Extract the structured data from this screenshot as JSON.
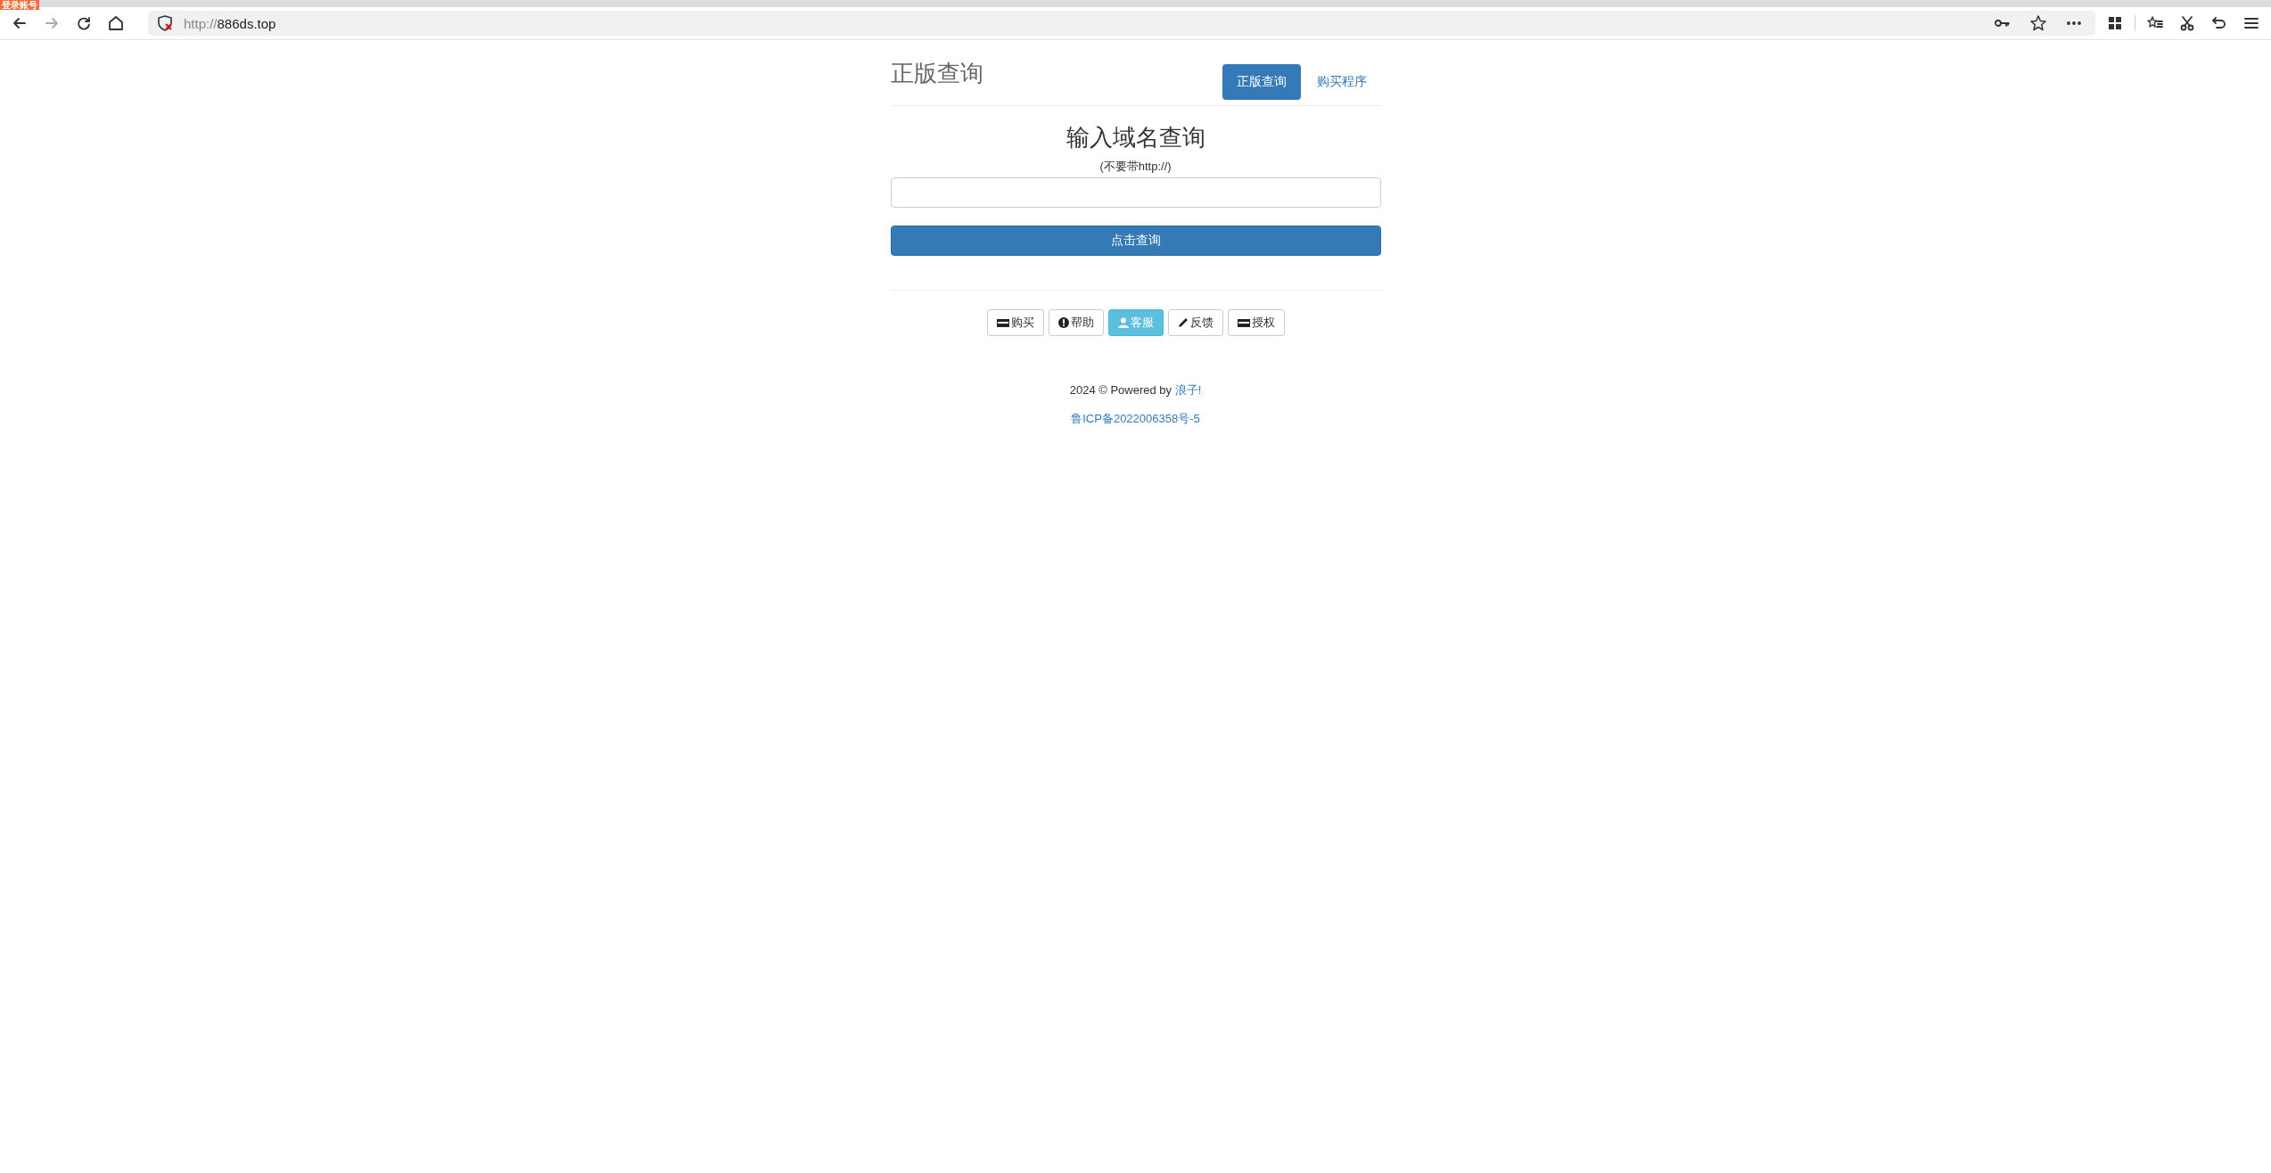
{
  "browser": {
    "badge": "登录账号",
    "url_scheme": "http://",
    "url_host": "886ds.top"
  },
  "header": {
    "title": "正版查询",
    "tabs": [
      {
        "label": "正版查询",
        "selected": true
      },
      {
        "label": "购买程序",
        "selected": false
      }
    ]
  },
  "query": {
    "heading": "输入域名查询",
    "hint": "(不要带http://)",
    "submit": "点击查询"
  },
  "actions": [
    {
      "label": "购买",
      "kind": "card",
      "selected": false
    },
    {
      "label": "帮助",
      "kind": "alert",
      "selected": false
    },
    {
      "label": "客服",
      "kind": "user",
      "selected": true
    },
    {
      "label": "反馈",
      "kind": "pencil",
      "selected": false
    },
    {
      "label": "授权",
      "kind": "card",
      "selected": false
    }
  ],
  "footer": {
    "copyright": "2024 © Powered by ",
    "author": "浪子!",
    "icp": "鲁ICP备2022006358号-5"
  }
}
